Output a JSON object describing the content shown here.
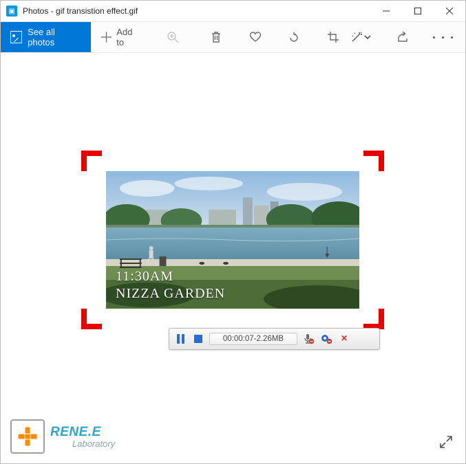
{
  "window": {
    "title": "Photos - gif transistion effect.gif"
  },
  "toolbar": {
    "see_all_label": "See all photos",
    "add_to_label": "Add to"
  },
  "image_overlay": {
    "time": "11:30AM",
    "place": "NIZZA GARDEN"
  },
  "recorder": {
    "readout": "00:00:07-2.26MB"
  },
  "logo": {
    "line1": "RENE.E",
    "line2": "Laboratory"
  },
  "colors": {
    "accent": "#0078d7",
    "capture_corner": "#e60000",
    "recorder_blue": "#2a6ad4"
  }
}
